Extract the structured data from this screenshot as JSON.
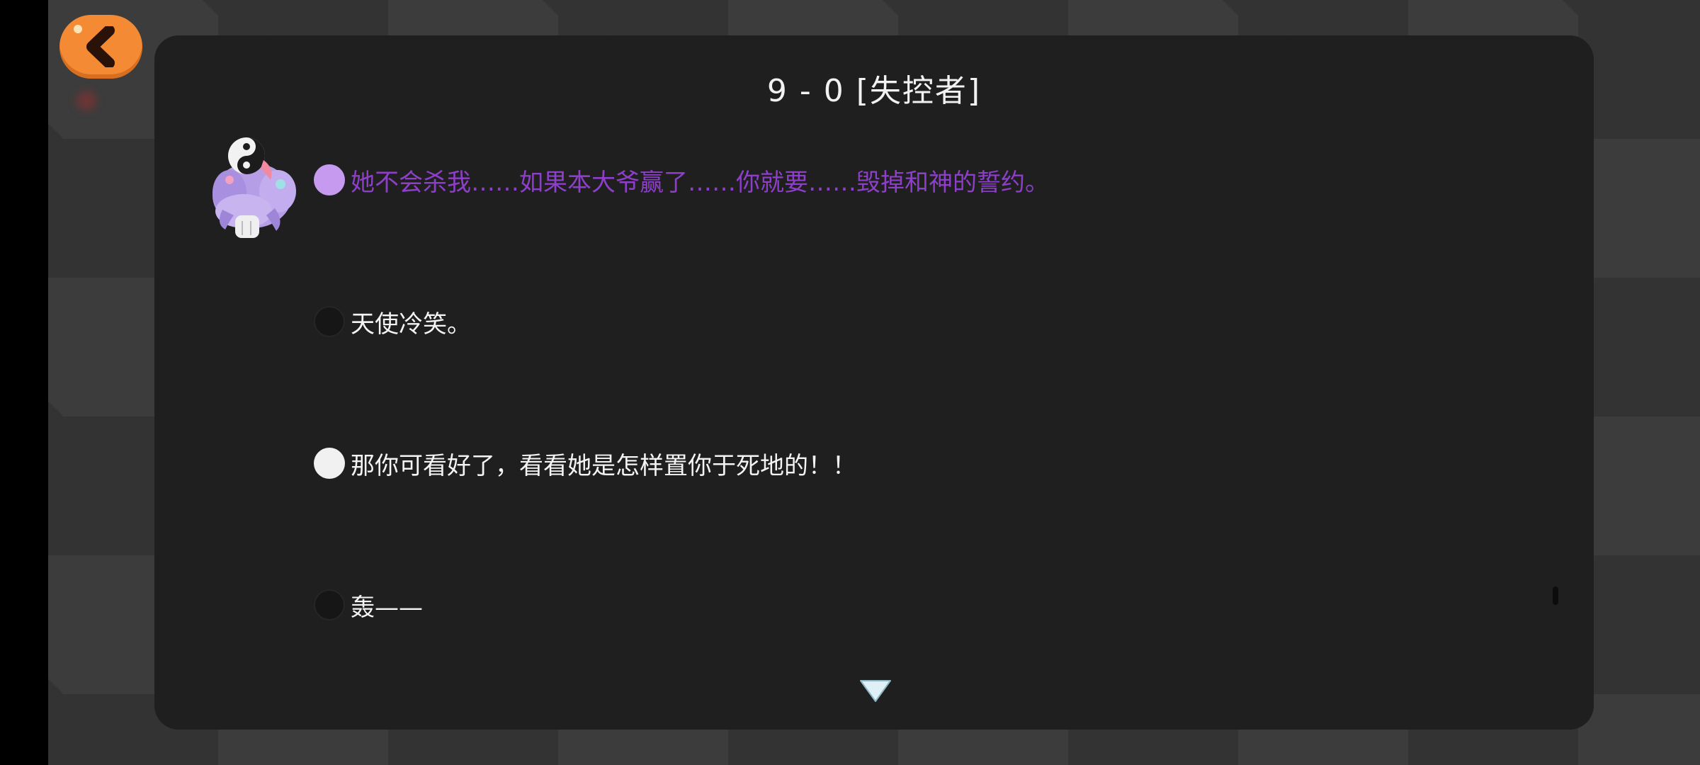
{
  "stage_title": "9 - 0 [失控者]",
  "dialogue": [
    {
      "speaker": "purple",
      "text": "她不会杀我……如果本大爷赢了……你就要……毁掉和神的誓约。"
    },
    {
      "speaker": "narration",
      "text": "天使冷笑。"
    },
    {
      "speaker": "white",
      "text": "那你可看好了，看看她是怎样置你于死地的！！"
    },
    {
      "speaker": "narration",
      "text": "轰——"
    }
  ],
  "colors": {
    "accent_orange": "#f58a34",
    "purple_speaker": "#8d3fc9",
    "purple_dot": "#c69bef",
    "panel": "#1e1e1e"
  },
  "icons": {
    "back": "chevron-left-icon",
    "next": "triangle-down-icon",
    "avatar": "purple-ghost-character"
  }
}
